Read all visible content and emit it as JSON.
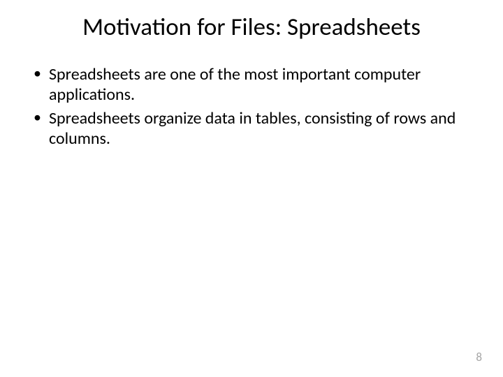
{
  "slide": {
    "title": "Motivation for Files: Spreadsheets",
    "bullets": [
      "Spreadsheets are one of the most important computer applications.",
      "Spreadsheets organize data in tables, consisting of rows and columns."
    ],
    "page_number": "8"
  }
}
